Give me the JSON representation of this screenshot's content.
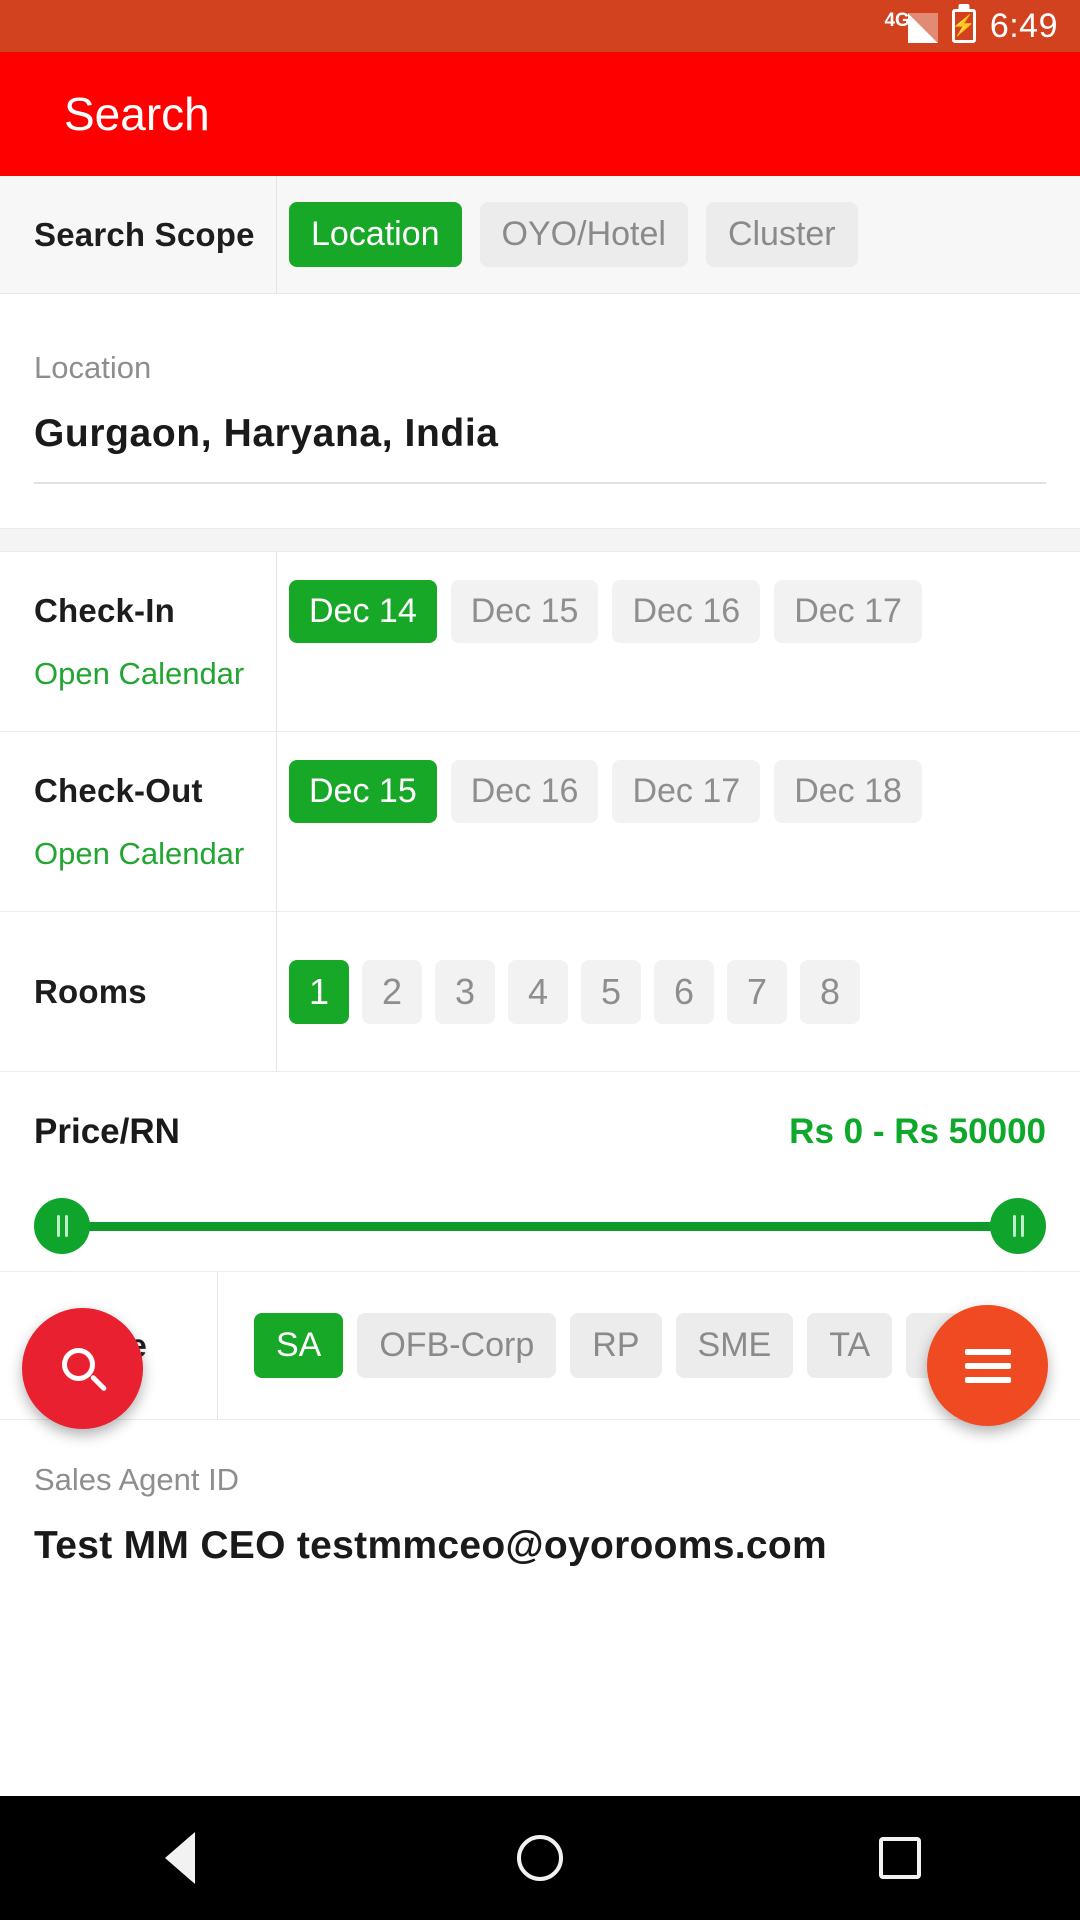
{
  "statusbar": {
    "network": "4G",
    "time": "6:49",
    "signal_icon": "signal-bars-icon",
    "battery_icon": "battery-charging-icon"
  },
  "appbar": {
    "title": "Search"
  },
  "search_scope": {
    "label": "Search Scope",
    "options": [
      {
        "label": "Location",
        "selected": true
      },
      {
        "label": "OYO/Hotel",
        "selected": false
      },
      {
        "label": "Cluster",
        "selected": false
      }
    ]
  },
  "location": {
    "label": "Location",
    "value": "Gurgaon,  Haryana,  India"
  },
  "checkin": {
    "label": "Check-In",
    "calendar_link": "Open Calendar",
    "dates": [
      {
        "label": "Dec 14",
        "selected": true
      },
      {
        "label": "Dec 15",
        "selected": false
      },
      {
        "label": "Dec 16",
        "selected": false
      },
      {
        "label": "Dec 17",
        "selected": false
      }
    ]
  },
  "checkout": {
    "label": "Check-Out",
    "calendar_link": "Open Calendar",
    "dates": [
      {
        "label": "Dec 15",
        "selected": true
      },
      {
        "label": "Dec 16",
        "selected": false
      },
      {
        "label": "Dec 17",
        "selected": false
      },
      {
        "label": "Dec 18",
        "selected": false
      }
    ]
  },
  "rooms": {
    "label": "Rooms",
    "options": [
      {
        "label": "1",
        "selected": true
      },
      {
        "label": "2",
        "selected": false
      },
      {
        "label": "3",
        "selected": false
      },
      {
        "label": "4",
        "selected": false
      },
      {
        "label": "5",
        "selected": false
      },
      {
        "label": "6",
        "selected": false
      },
      {
        "label": "7",
        "selected": false
      },
      {
        "label": "8",
        "selected": false
      }
    ]
  },
  "price": {
    "label": "Price/RN",
    "value": "Rs 0 - Rs 50000",
    "min_position_pct": 0,
    "max_position_pct": 100,
    "accent": "#0fa52c"
  },
  "source": {
    "label": "Source",
    "options": [
      {
        "label": "SA",
        "selected": true
      },
      {
        "label": "OFB-Corp",
        "selected": false
      },
      {
        "label": "RP",
        "selected": false
      },
      {
        "label": "SME",
        "selected": false
      },
      {
        "label": "TA",
        "selected": false
      },
      {
        "label": "",
        "selected": false
      }
    ]
  },
  "agent": {
    "label": "Sales Agent ID",
    "value": "Test MM CEO testmmceo@oyorooms.com"
  },
  "fabs": {
    "search": {
      "icon": "search-icon",
      "color": "#e8202f"
    },
    "menu": {
      "icon": "hamburger-menu-icon",
      "color": "#f04a22"
    }
  },
  "navbar": {
    "back": "back-triangle-icon",
    "home": "home-circle-icon",
    "recents": "recents-square-icon"
  },
  "colors": {
    "appbar": "#ff0000",
    "statusbar": "#d2421f",
    "selected_chip": "#17a828",
    "green_text": "#22a531"
  }
}
